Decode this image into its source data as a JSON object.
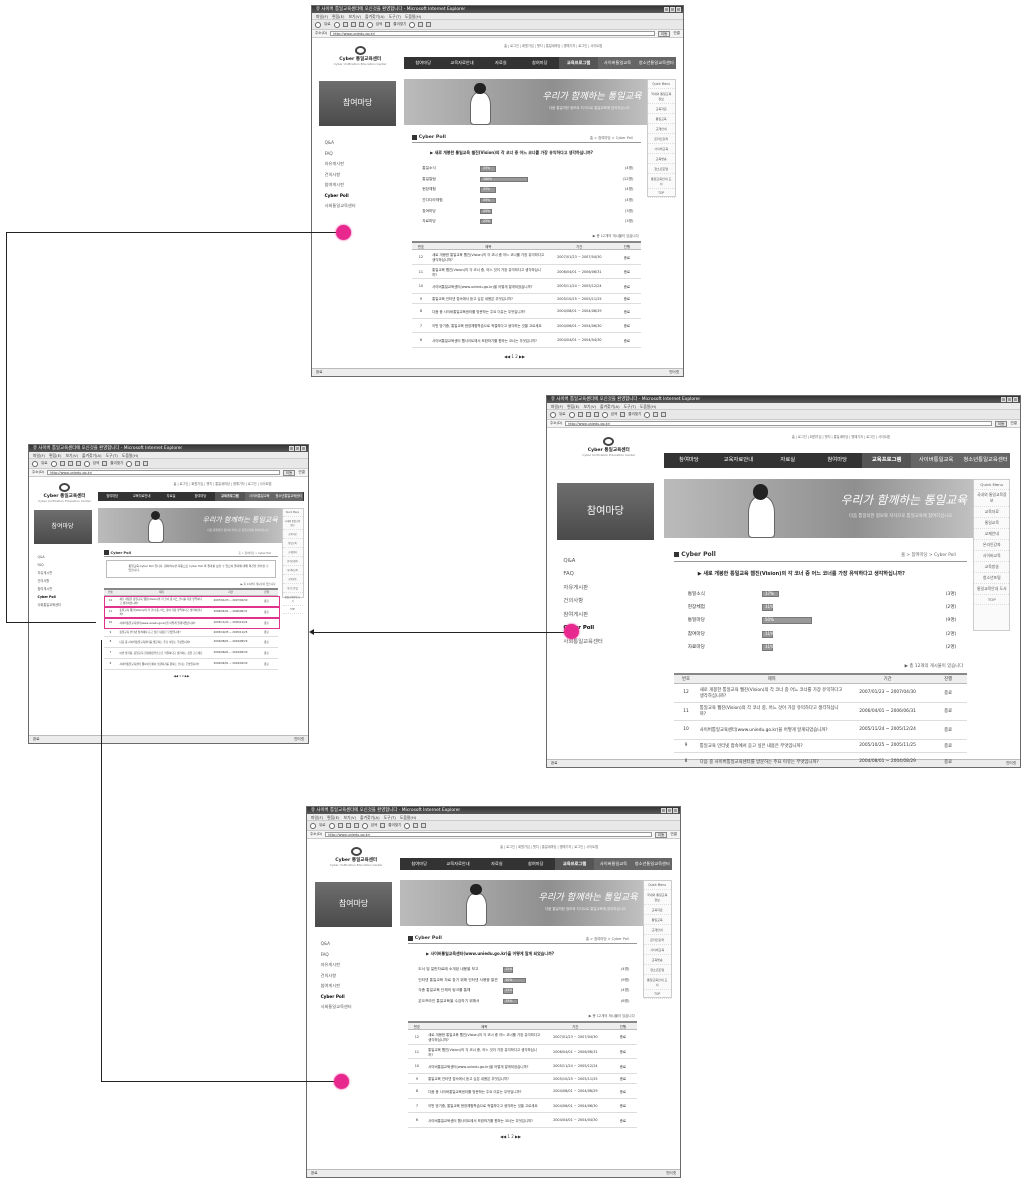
{
  "browser": {
    "title": "유 사이버 통일교육센터에 오신것을 환영합니다 - Microsoft Internet Explorer",
    "menu": [
      "파일(F)",
      "편집(E)",
      "보기(V)",
      "즐겨찾기(A)",
      "도구(T)",
      "도움말(H)"
    ],
    "back_label": "뒤로",
    "search_label": "검색",
    "favorites_label": "즐겨찾기",
    "address_label": "주소(D)",
    "url": "http://www.uniedu.go.kr/",
    "go_label": "이동",
    "links_label": "연결",
    "status_left": "완료",
    "status_right": "인터넷"
  },
  "site": {
    "logo_title": "Cyber 통일교육센터",
    "logo_sub": "Cyber Unification Education Center",
    "top_links": "홈 | 로그인 | 회원가입 | 챗지 | 통일새마당 | 명예기자 | 로그인 | 사이트맵",
    "gnb": [
      "참여마당",
      "교육자료안내",
      "자료실",
      "참여마당",
      "교육프로그램",
      "사이버통일교육",
      "청소년통일교육센터"
    ],
    "side_title": "참여마당",
    "side_menu": [
      "Q&A",
      "FAQ",
      "자유게시판",
      "건의사항",
      "참여게시판",
      "Cyber Poll",
      "사회통일교육센터"
    ],
    "banner_text": "우리가 함께하는 통일교육",
    "banner_sub": "다음 통일의한 정보와 지식으로 통일교육에 참여하십시오",
    "right_items": [
      "Quick Menu",
      "국내외 통일교육정보",
      "교육자료",
      "통일교육",
      "교재안내",
      "온라인강좌",
      "사이버교육",
      "교육방송",
      "청소년포털",
      "통일교육안내 도서",
      "TOP"
    ],
    "poll_title": "Cyber Poll",
    "crumb": "홈 > 참여마당 > Cyber Poll",
    "total_note": "▶ 총 12개의 게시물이 있습니다"
  },
  "poll1": {
    "question": "▶ 새로 개봉한 통일교육 웹진(Vision)의 각 코너 중 어느 코너를 가장 유익하다고 생각하십니까?",
    "options": [
      {
        "label": "통일소식",
        "pct": 33,
        "pct_text": "33%",
        "count": "(4명)"
      },
      {
        "label": "통일칼럼",
        "pct": 100,
        "pct_text": "100%",
        "count": "(12명)"
      },
      {
        "label": "현장체험",
        "pct": 33,
        "pct_text": "33%",
        "count": "(4명)"
      },
      {
        "label": "간다다라체험",
        "pct": 33,
        "pct_text": "33%",
        "count": "(4명)"
      },
      {
        "label": "참여마당",
        "pct": 25,
        "pct_text": "25%",
        "count": "(3명)"
      },
      {
        "label": "자료마당",
        "pct": 25,
        "pct_text": "25%",
        "count": "(3명)"
      }
    ]
  },
  "poll2": {
    "question": "▶ 새로 개봉한 통일교육 웹진(Vision)의 각 코너 중 어느 코너를 가장 유익하다고 생각하십니까?",
    "options": [
      {
        "label": "통일소식",
        "pct": 17,
        "pct_text": "17%",
        "count": "(3명)"
      },
      {
        "label": "현장체험",
        "pct": 11,
        "pct_text": "11%",
        "count": "(2명)"
      },
      {
        "label": "통일마당",
        "pct": 50,
        "pct_text": "50%",
        "count": "(9명)"
      },
      {
        "label": "참여마당",
        "pct": 11,
        "pct_text": "11%",
        "count": "(2명)"
      },
      {
        "label": "자료마당",
        "pct": 11,
        "pct_text": "11%",
        "count": "(2명)"
      }
    ]
  },
  "poll3": {
    "question": "▶ 사이버통일교육센터(www.uniedu.go.kr)을 어떻게 알게 되었습니까?",
    "options": [
      {
        "label": "도서 및 일반자료에 소개된 내용을 보고",
        "pct": 22,
        "pct_text": "22%",
        "count": "(4명)"
      },
      {
        "label": "인터넷 통일교육 자료 찾기 위해 인터넷 사용중 발견",
        "pct": 50,
        "pct_text": "50%",
        "count": "(9명)"
      },
      {
        "label": "각종 통일교육 단체의 링크를 통해",
        "pct": 22,
        "pct_text": "22%",
        "count": "(4명)"
      },
      {
        "label": "온오프라인 통일교육을 수강하기 위해서",
        "pct": 33,
        "pct_text": "33%",
        "count": "(6명)"
      }
    ]
  },
  "list": {
    "headers": [
      "번호",
      "제목",
      "기간",
      "진행"
    ],
    "rows": [
      {
        "no": "12",
        "title": "새로 개봉한 통일교육 웹진(Vision)의 각 코너 중 어느 코너를 가장 유익하다고 생각하십니까?",
        "period": "2007/01/23 ~ 2007/04/30",
        "state": "종료"
      },
      {
        "no": "11",
        "title": "통일교육 웹진(Vision)의 각 코너 중, 어느 것이 가장 유익하다고 생각하십니까?",
        "period": "2006/04/01 ~ 2006/06/31",
        "state": "종료"
      },
      {
        "no": "10",
        "title": "사이버통일교육센터(www.uniedu.go.kr)을 어떻게 알게되었습니까?",
        "period": "2005/11/24 ~ 2005/12/24",
        "state": "종료"
      },
      {
        "no": "9",
        "title": "통일교육 인터넷 접속에서 듣고 싶은 내용은 무엇입니까?",
        "period": "2005/10/25 ~ 2005/11/25",
        "state": "종료"
      },
      {
        "no": "8",
        "title": "다음 중 사이버통일교육센터를 방문하는 주요 이유는 무엇입니까?",
        "period": "2004/08/01 ~ 2004/08/29",
        "state": "종료"
      },
      {
        "no": "7",
        "title": "이번 방기중, 통일교육 현장체험학습으로 적절하다고 생각하는 것을 고르세요",
        "period": "2004/06/01 ~ 2004/06/30",
        "state": "종료"
      },
      {
        "no": "6",
        "title": "사이버통일교육센터 웹사이트에서 보완하기를 원하는 코너는 무엇입니까?",
        "period": "2004/04/01 ~ 2004/04/30",
        "state": "종료"
      }
    ],
    "pages": "◀◀  1  2  ▶▶"
  },
  "main_notice": "통일교육 Cyber Poll 입니다. 참여하시면 자동으로 Cyber Poll 의 결과를 보실 수 있으며 결과에 대해 의견을 올리실 수 있습니다.",
  "colors": {
    "highlight": "#e0338c",
    "nav_dark": "#333333",
    "poll_bar": "#999999"
  }
}
